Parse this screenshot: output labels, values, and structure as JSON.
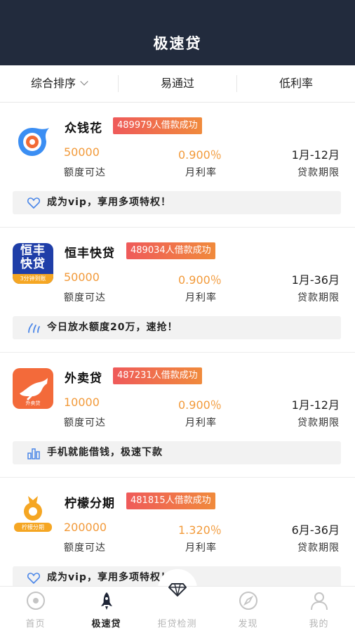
{
  "header": {
    "title": "极速贷"
  },
  "filters": {
    "sort": "综合排序",
    "easy": "易通过",
    "low_rate": "低利率"
  },
  "products": [
    {
      "name": "众钱花",
      "badge": "489979人借款成功",
      "amount": "50000",
      "amount_label": "额度可达",
      "rate": "0.900％",
      "rate_label": "月利率",
      "term": "1月-12月",
      "term_label": "贷款期限",
      "tip": "成为vip，享用多项特权！",
      "tip_icon": "heart-icon",
      "logo_icon": "blue-swirl-logo"
    },
    {
      "name": "恒丰快贷",
      "badge": "489034人借款成功",
      "amount": "50000",
      "amount_label": "额度可达",
      "rate": "0.900％",
      "rate_label": "月利率",
      "term": "1月-36月",
      "term_label": "贷款期限",
      "tip": "今日放水额度20万，速抢！",
      "tip_icon": "water-icon",
      "logo_icon": "hengfeng-logo",
      "logo_text1": "恒丰",
      "logo_text2": "快贷",
      "logo_sub": "3分钟到账"
    },
    {
      "name": "外卖贷",
      "badge": "487231人借款成功",
      "amount": "10000",
      "amount_label": "额度可达",
      "rate": "0.900％",
      "rate_label": "月利率",
      "term": "1月-12月",
      "term_label": "贷款期限",
      "tip": "手机就能借钱，极速下款",
      "tip_icon": "bar-chart-icon",
      "logo_icon": "kangaroo-logo",
      "logo_sub": "外卖贷"
    },
    {
      "name": "柠檬分期",
      "badge": "481815人借款成功",
      "amount": "200000",
      "amount_label": "额度可达",
      "rate": "1.320％",
      "rate_label": "月利率",
      "term": "6月-36月",
      "term_label": "贷款期限",
      "tip": "成为vip，享用多项特权！",
      "tip_icon": "heart-icon",
      "logo_icon": "lemon-logo",
      "logo_sub": "柠檬分期"
    }
  ],
  "tabbar": [
    {
      "label": "首页",
      "icon": "home-icon",
      "active": false
    },
    {
      "label": "极速贷",
      "icon": "rocket-icon",
      "active": true
    },
    {
      "label": "拒贷检测",
      "icon": "diamond-icon",
      "active": false
    },
    {
      "label": "发现",
      "icon": "compass-icon",
      "active": false
    },
    {
      "label": "我的",
      "icon": "user-icon",
      "active": false
    }
  ],
  "colors": {
    "header_bg": "#222b3d",
    "accent_orange": "#f29a3a",
    "badge_start": "#ef5a5a",
    "badge_end": "#f08a3c",
    "tip_icon_blue": "#4a86e8"
  }
}
